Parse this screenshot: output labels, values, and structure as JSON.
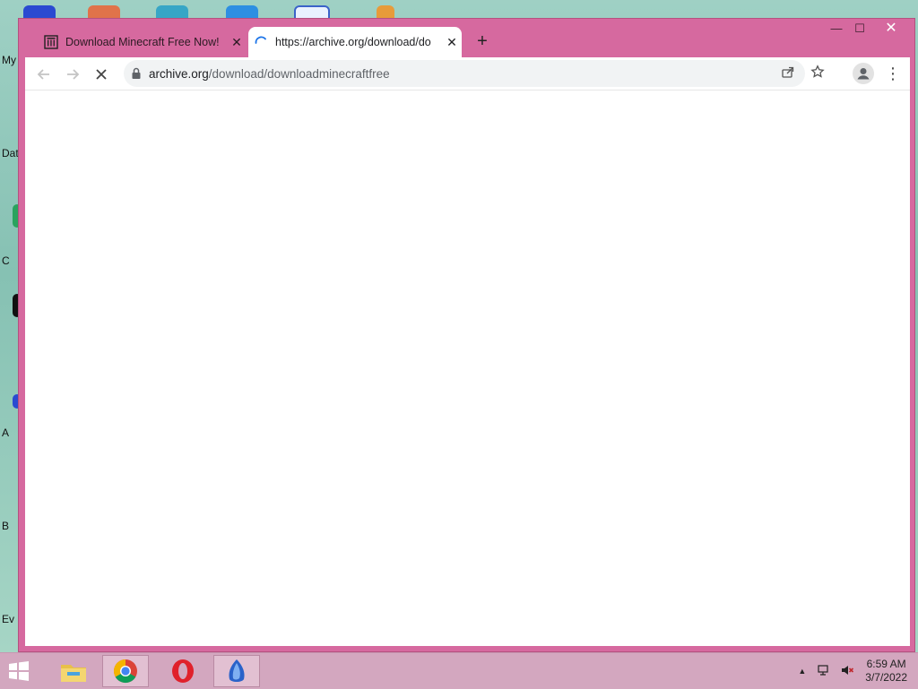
{
  "desktop": {
    "side_fragments": [
      "My",
      "Dat",
      "C",
      "A",
      "B",
      "Ev"
    ]
  },
  "browser": {
    "tabs": [
      {
        "title": "Download Minecraft Free Now!",
        "state": "inactive"
      },
      {
        "title": "https://archive.org/download/do",
        "state": "loading"
      }
    ],
    "new_tab": "+",
    "window_controls": {
      "minimize": "—",
      "maximize": "☐",
      "close": "✕"
    },
    "address": {
      "host": "archive.org",
      "path": "/download/downloadminecraftfree"
    }
  },
  "taskbar": {
    "time": "6:59 AM",
    "date": "3/7/2022"
  },
  "colors": {
    "window_frame": "#d6699f",
    "taskbar": "#d3a7bf",
    "content_bg": "#ffffff"
  }
}
